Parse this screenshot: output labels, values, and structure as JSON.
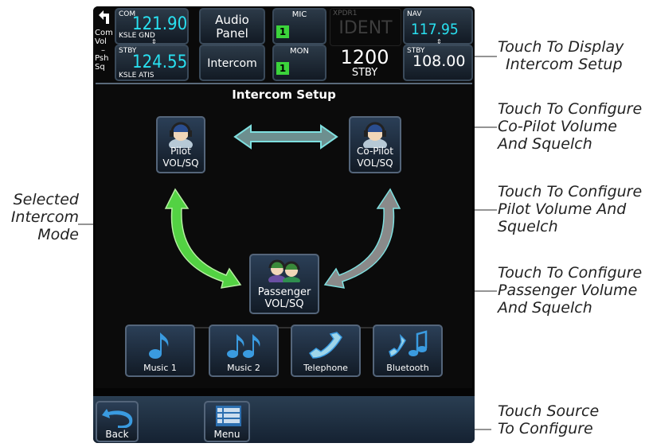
{
  "top_bar": {
    "com": {
      "label": "COM",
      "active_freq": "121.90",
      "active_id": "KSLE GND",
      "stby_label": "STBY",
      "stby_freq": "124.55",
      "stby_id": "KSLE ATIS",
      "swap": "⇕"
    },
    "side_labels": {
      "com_vol": "Com Vol",
      "dash": "–",
      "psh_sq": "Psh Sq"
    },
    "audio_panel": {
      "line1": "Audio",
      "line2": "Panel"
    },
    "intercom_button": "Intercom",
    "mic": {
      "label": "MIC",
      "value": "1"
    },
    "mon": {
      "label": "MON",
      "value": "1"
    },
    "xpdr": {
      "label": "XPDR1",
      "ident": "IDENT",
      "code": "1200",
      "mode": "STBY"
    },
    "nav": {
      "label": "NAV",
      "active_freq": "117.95",
      "stby_label": "STBY",
      "stby_freq": "108.00",
      "swap": "⇕"
    }
  },
  "intercom": {
    "title": "Intercom Setup",
    "pilot": {
      "line1": "Pilot",
      "line2": "VOL/SQ",
      "icon": "pilot-headset-icon"
    },
    "copilot": {
      "line1": "Co-Pilot",
      "line2": "VOL/SQ",
      "icon": "copilot-headset-icon"
    },
    "passenger": {
      "line1": "Passenger",
      "line2": "VOL/SQ",
      "icon": "passengers-headset-icon"
    },
    "colors": {
      "selected": "#53d243",
      "unselected_double": "#5aa4a4",
      "gray": "#8a8a8a"
    }
  },
  "sources": [
    {
      "label": "Music 1",
      "icon": "music-note-icon"
    },
    {
      "label": "Music 2",
      "icon": "music-notes-icon"
    },
    {
      "label": "Telephone",
      "icon": "telephone-icon"
    },
    {
      "label": "Bluetooth",
      "icon": "bluetooth-phone-icon"
    }
  ],
  "bottom": {
    "back": "Back",
    "menu": "Menu"
  },
  "callouts": {
    "intercom": [
      "Touch To Display",
      "Intercom Setup"
    ],
    "copilot": [
      "Touch To Configure",
      "Co-Pilot Volume",
      "And Squelch"
    ],
    "pilot": [
      "Touch To Configure",
      "Pilot Volume And",
      "Squelch"
    ],
    "passenger": [
      "Touch To Configure",
      "Passenger Volume",
      "And Squelch"
    ],
    "source": [
      "Touch Source",
      "To Configure"
    ],
    "selected_mode": [
      "Selected",
      "Intercom",
      "Mode"
    ]
  }
}
